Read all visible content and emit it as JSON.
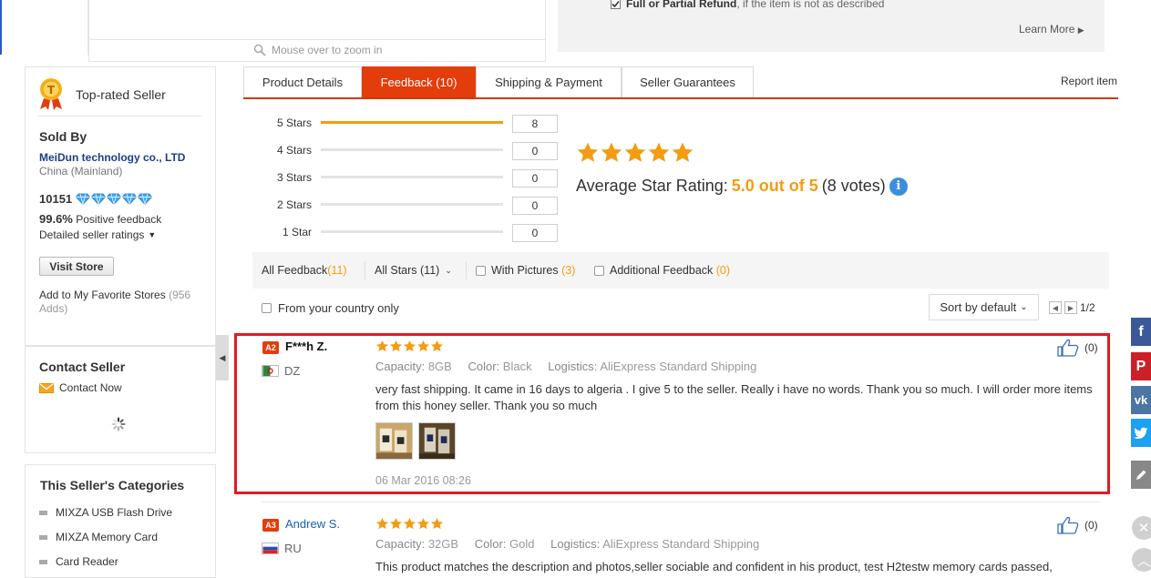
{
  "zoom": {
    "hint": "Mouse over to zoom in"
  },
  "guarantee": {
    "title": "Full or Partial Refund",
    "text": ", if the item is not as described",
    "learn_more": "Learn More"
  },
  "seller": {
    "badge": "Top-rated Seller",
    "sold_by": "Sold By",
    "store_name": "MeiDun technology co., LTD",
    "country": "China (Mainland)",
    "score": "10151",
    "positive_pct": "99.6%",
    "positive_label": "Positive feedback",
    "detailed_ratings": "Detailed seller ratings",
    "visit_store": "Visit Store",
    "fav_label": "Add to My Favorite Stores",
    "fav_count": "(956 Adds)"
  },
  "contact": {
    "title": "Contact Seller",
    "contact_now": "Contact Now"
  },
  "categories": {
    "title": "This Seller's Categories",
    "items": [
      "MIXZA USB Flash Drive",
      "MIXZA Memory Card",
      "Card Reader"
    ]
  },
  "tabs": [
    {
      "label": "Product Details",
      "active": false
    },
    {
      "label": "Feedback (10)",
      "active": true
    },
    {
      "label": "Shipping & Payment",
      "active": false
    },
    {
      "label": "Seller Guarantees",
      "active": false
    }
  ],
  "report_item": "Report item",
  "histogram": [
    {
      "label": "5 Stars",
      "count": "8",
      "fraction": 1.0
    },
    {
      "label": "4 Stars",
      "count": "0",
      "fraction": 0
    },
    {
      "label": "3 Stars",
      "count": "0",
      "fraction": 0
    },
    {
      "label": "2 Stars",
      "count": "0",
      "fraction": 0
    },
    {
      "label": "1 Star",
      "count": "0",
      "fraction": 0
    }
  ],
  "average": {
    "label": "Average Star Rating:",
    "value": "5.0 out of 5",
    "votes": "(8 votes)",
    "info": "i",
    "stars": 5
  },
  "filters": {
    "all_feedback": "All Feedback",
    "all_feedback_count": "(11)",
    "all_stars": "All Stars (11)",
    "with_pictures": "With Pictures",
    "with_pictures_count": "(3)",
    "additional": "Additional Feedback",
    "additional_count": "(0)",
    "country_only": "From your country only",
    "sort": "Sort by default",
    "page": "1/2"
  },
  "reviews": [
    {
      "level": "A2",
      "name": "F***h Z.",
      "country": "DZ",
      "stars": 5,
      "capacity_label": "Capacity:",
      "capacity": "8GB",
      "color_label": "Color:",
      "color": "Black",
      "logistics_label": "Logistics:",
      "logistics": "AliExpress Standard Shipping",
      "text": "very fast shipping. It came in 16 days to algeria . I give 5 to the seller. Really i have no words. Thank you so much. I will order more items from this honey seller. Thank you so much",
      "date": "06 Mar 2016 08:26",
      "likes": "(0)"
    },
    {
      "level": "A3",
      "name": "Andrew S.",
      "country": "RU",
      "stars": 5,
      "capacity_label": "Capacity:",
      "capacity": "32GB",
      "color_label": "Color:",
      "color": "Gold",
      "logistics_label": "Logistics:",
      "logistics": "AliExpress Standard Shipping",
      "text": "This product matches the description and photos,seller sociable and confident in his product, test H2testw memory cards passed,",
      "likes": "(0)"
    }
  ],
  "colors": {
    "accent": "#e23d0b",
    "star": "#f39c12",
    "link": "#1b5fb4",
    "highlight": "#e01b24"
  }
}
